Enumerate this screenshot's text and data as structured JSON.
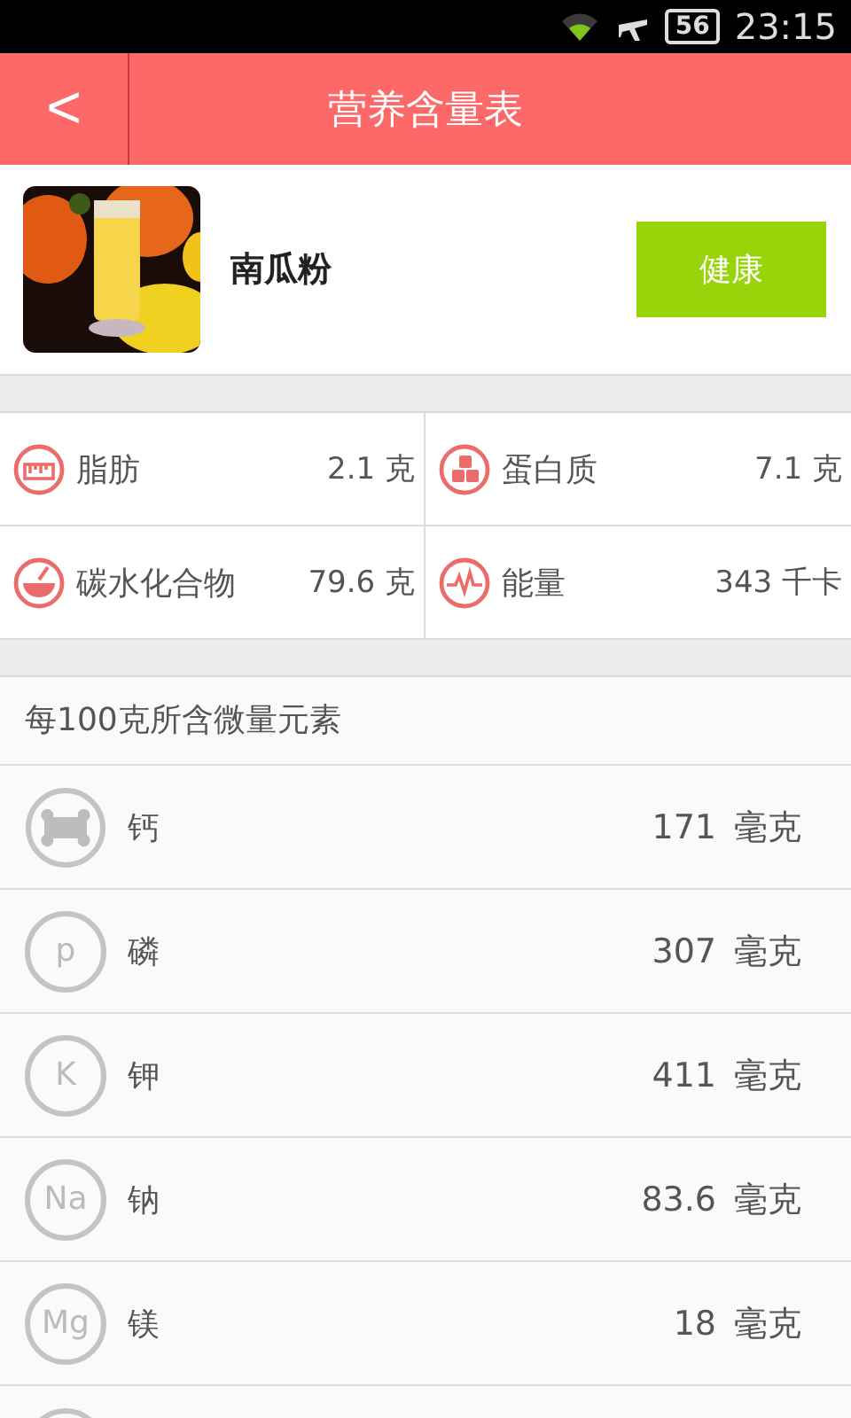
{
  "status_bar": {
    "battery": "56",
    "time": "23:15"
  },
  "header": {
    "back": "<",
    "title": "营养含量表"
  },
  "food": {
    "name": "南瓜粉",
    "tag_button": "健康"
  },
  "nutrients": [
    {
      "kind": "fat",
      "name": "脂肪",
      "value": "2.1 克"
    },
    {
      "kind": "protein",
      "name": "蛋白质",
      "value": "7.1 克"
    },
    {
      "kind": "carb",
      "name": "碳水化合物",
      "value": "79.6 克"
    },
    {
      "kind": "energy",
      "name": "能量",
      "value": "343 千卡"
    }
  ],
  "minerals_title": "每100克所含微量元素",
  "minerals": [
    {
      "kind": "bone",
      "name": "钙",
      "amount": "171",
      "unit": "毫克"
    },
    {
      "kind": "symbol",
      "symbol": "p",
      "name": "磷",
      "amount": "307",
      "unit": "毫克"
    },
    {
      "kind": "symbol",
      "symbol": "K",
      "name": "钾",
      "amount": "411",
      "unit": "毫克"
    },
    {
      "kind": "symbol",
      "symbol": "Na",
      "name": "钠",
      "amount": "83.6",
      "unit": "毫克"
    },
    {
      "kind": "symbol",
      "symbol": "Mg",
      "name": "镁",
      "amount": "18",
      "unit": "毫克"
    },
    {
      "kind": "blank"
    }
  ]
}
